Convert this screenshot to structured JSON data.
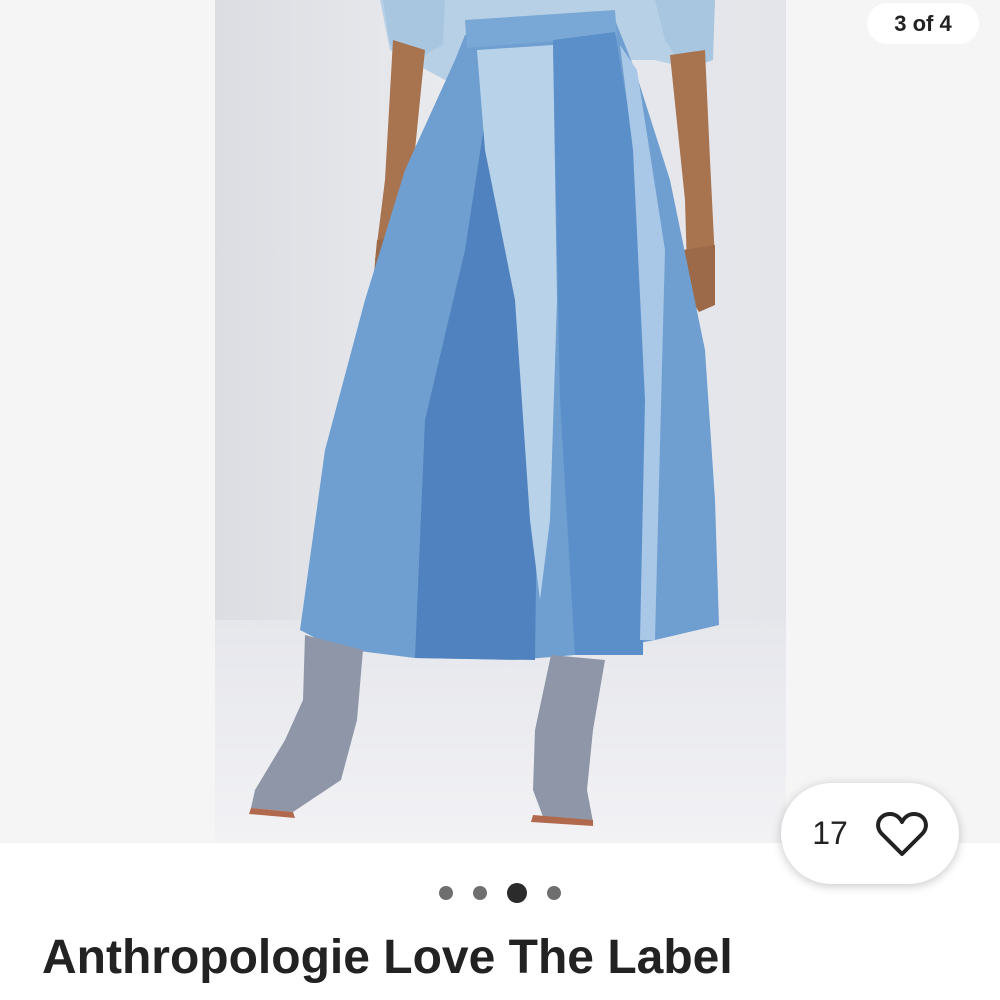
{
  "gallery": {
    "image_alt": "Patchwork denim midi skirt with ankle boots",
    "counter": "3 of 4",
    "total": 4,
    "current": 3
  },
  "favorites": {
    "count": "17",
    "icon": "heart-outline-icon"
  },
  "listing": {
    "title": "Anthropologie Love The Label"
  },
  "colors": {
    "background": "#ffffff",
    "text": "#222222",
    "dot_active": "#2b2b2b",
    "dot_inactive": "#6f6f6f"
  }
}
